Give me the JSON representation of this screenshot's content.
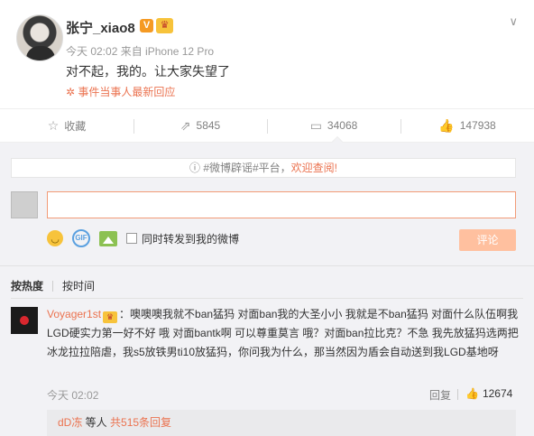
{
  "post": {
    "username": "张宁_xiao8",
    "verified_badge": "V",
    "vip_badge": "♛",
    "chevron": "∨",
    "time": "今天 02:02",
    "source": "来自 iPhone 12 Pro",
    "content": "对不起，我的。让大家失望了",
    "event_label": "✲ 事件当事人最新回应"
  },
  "actions": [
    {
      "label": "收藏",
      "icon": "star-icon",
      "glyph": "☆"
    },
    {
      "label": "5845",
      "icon": "repost-icon",
      "glyph": "⇗"
    },
    {
      "label": "34068",
      "icon": "comment-icon",
      "glyph": "▭"
    },
    {
      "label": "147938",
      "icon": "like-icon",
      "glyph": "👍"
    }
  ],
  "comment_box": {
    "notice_prefix": "ⓘ #微博辟谣#平台，",
    "notice_highlight": "欢迎查阅!",
    "placeholder": "",
    "repost_label": "同时转发到我的微博",
    "submit_label": "评论"
  },
  "sort": {
    "hot": "按热度",
    "time": "按时间"
  },
  "comments": [
    {
      "user": "Voyager1st",
      "vip": "♛",
      "text": "：噢噢噢我就不ban猛犸 对面ban我的大圣小小 我就是不ban猛犸 对面什么队伍啊我LGD硬实力第一好不好 哦 对面bantk啊 可以尊重莫言 哦？对面ban拉比克？不急 我先放猛犸选两把冰龙拉拉陪虐，我s5放铁男ti10放猛犸，你问我为什么，那当然因为盾会自动送到我LGD基地呀",
      "time": "今天 02:02",
      "reply_label": "回复",
      "likes": "12674",
      "sub_user": "dD冻",
      "sub_text": " 等人 ",
      "sub_link": "共515条回复"
    }
  ],
  "colors": {
    "accent": "#eb7350",
    "panel_bg": "#f2f2f5",
    "input_border": "#f29b77",
    "button_disabled": "#ffc09f"
  }
}
